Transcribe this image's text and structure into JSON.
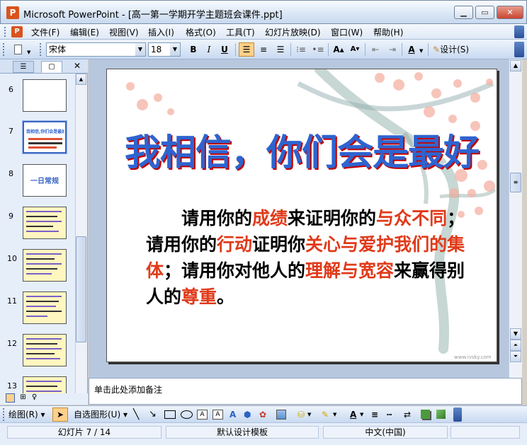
{
  "window": {
    "app_name": "Microsoft PowerPoint",
    "title": "Microsoft PowerPoint - [高一第一学期开学主题班会课件.ppt]",
    "minimize_icon": "minimize-icon",
    "maximize_icon": "maximize-icon",
    "close_icon": "close-icon"
  },
  "menu": {
    "items": [
      "文件(F)",
      "编辑(E)",
      "视图(V)",
      "插入(I)",
      "格式(O)",
      "工具(T)",
      "幻灯片放映(D)",
      "窗口(W)",
      "帮助(H)"
    ]
  },
  "toolbar": {
    "font_name": "宋体",
    "font_size": "18",
    "bold": "B",
    "italic": "I",
    "underline": "U",
    "design_label": "设计(S)"
  },
  "thumbnails": {
    "numbers": [
      "6",
      "7",
      "8",
      "9",
      "10",
      "11",
      "12",
      "13"
    ],
    "selected": "7",
    "slide8_text": "一日常规",
    "slide7_text": "我相信,你们会是最好"
  },
  "slide": {
    "title": "我相信，你们会是最好",
    "body": {
      "s1": "请用你的",
      "s2": "成绩",
      "s3": "来证明你的",
      "s4": "与众",
      "s5": "不同",
      "s6": "；请用你的",
      "s7": "行动",
      "s8": "证明你",
      "s9": "关心与",
      "s10": "爱护我们的集体",
      "s11": "；请用你对他人的",
      "s12": "理解与宽容",
      "s13": "来赢得别人的",
      "s14": "尊重",
      "s15": "。"
    },
    "watermark_url": "www.ivsky.com",
    "title_color": "#2e64d0",
    "highlight_color": "#e03a1a"
  },
  "notes": {
    "placeholder": "单击此处添加备注"
  },
  "drawing_toolbar": {
    "draw_label": "绘图(R)",
    "autoshapes_label": "自选图形(U)"
  },
  "status": {
    "slide_position": "幻灯片 7 / 14",
    "design_template": "默认设计模板",
    "language": "中文(中国)"
  }
}
